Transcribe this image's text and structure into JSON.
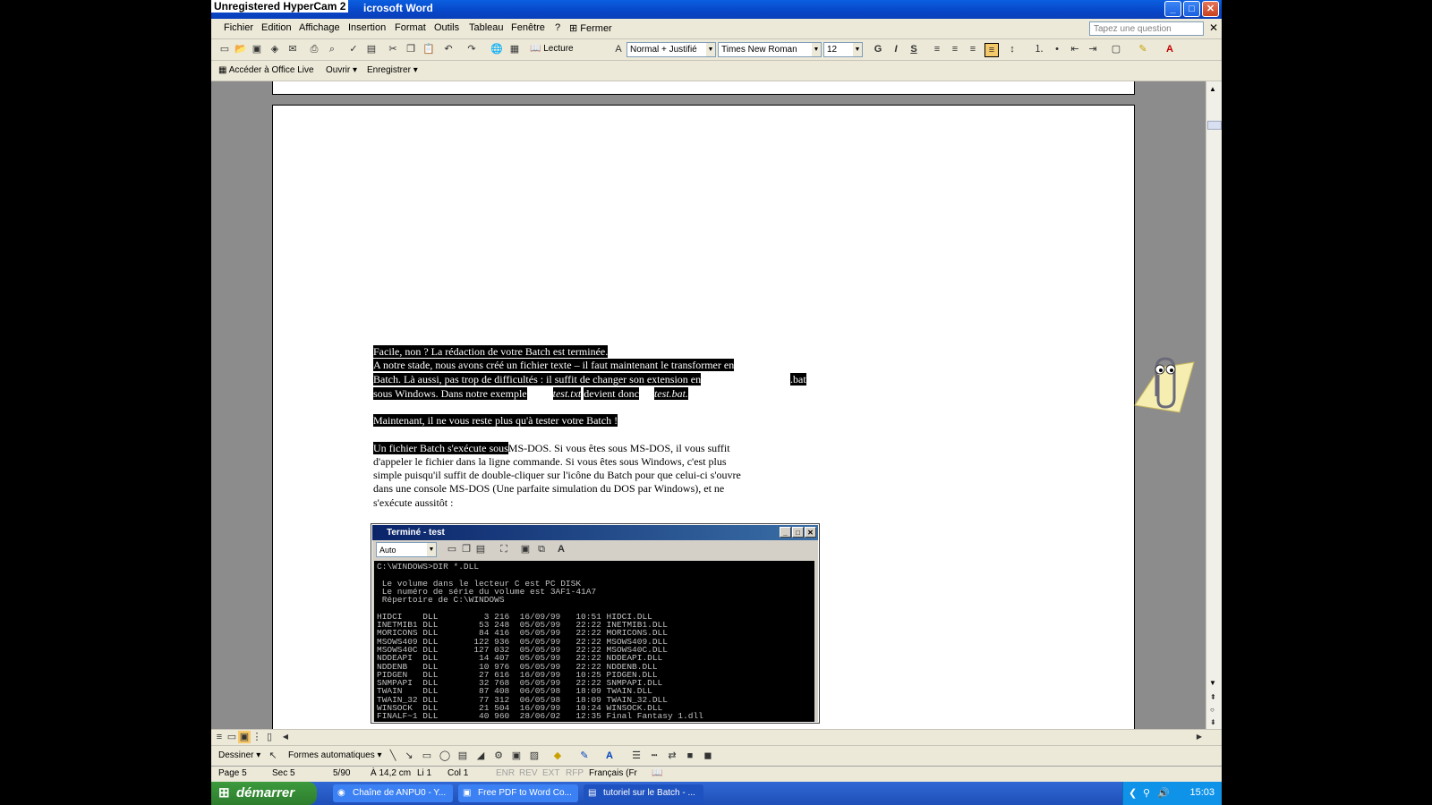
{
  "window": {
    "watermark": "Unregistered HyperCam 2",
    "title": "icrosoft Word",
    "buttons": {
      "minimize": "_",
      "maximize": "□",
      "close": "✕"
    }
  },
  "menu": {
    "items": [
      "Fichier",
      "Edition",
      "Affichage",
      "Insertion",
      "Format",
      "Outils",
      "Tableau",
      "Fenêtre",
      "?"
    ],
    "close_label": "Fermer",
    "help_placeholder": "Tapez une question"
  },
  "toolbar": {
    "reading": "Lecture",
    "style": "Normal + Justifié",
    "font": "Times New Roman",
    "size": "12",
    "bold": "G",
    "italic": "I",
    "strike": "S"
  },
  "toolbar2": {
    "office_live": "Accéder à Office Live",
    "open": "Ouvrir",
    "save": "Enregistrer"
  },
  "document": {
    "lines": [
      "Facile, non ? La rédaction de votre Batch est terminée.",
      "A notre stade, nous avons créé un fichier texte – il faut maintenant le transformer en",
      "Batch. Là aussi, pas trop de difficultés : il suffit de changer son extension en",
      ".bat",
      "sous Windows. Dans notre exemple",
      "test.txt",
      "devient donc",
      "test.bat.",
      "Maintenant, il ne vous reste plus qu'à tester votre Batch !",
      "Un fichier Batch s'exécute sous",
      "MS-DOS. Si vous êtes sous MS-DOS, il vous suffit",
      "d'appeler le fichier dans la ligne commande. Si vous êtes sous Windows, c'est plus",
      "simple puisqu'il suffit de double-cliquer sur l'icône du Batch pour que celui-ci s'ouvre",
      "dans une console MS-DOS (Une parfaite simulation du DOS par Windows), et ne",
      "s'exécute aussitôt :"
    ]
  },
  "console": {
    "title": "Terminé - test",
    "font_select": "Auto",
    "lines": [
      "C:\\WINDOWS>DIR *.DLL",
      "",
      " Le volume dans le lecteur C est PC DISK",
      " Le numéro de série du volume est 3AF1-41A7",
      " Répertoire de C:\\WINDOWS",
      "",
      "HIDCI    DLL         3 216  16/09/99   10:51 HIDCI.DLL",
      "INETMIB1 DLL        53 248  05/05/99   22:22 INETMIB1.DLL",
      "MORICONS DLL        84 416  05/05/99   22:22 MORICONS.DLL",
      "MSOWS409 DLL       122 936  05/05/99   22:22 MSOWS409.DLL",
      "MSOWS40C DLL       127 032  05/05/99   22:22 MSOWS40C.DLL",
      "NDDEAPI  DLL        14 407  05/05/99   22:22 NDDEAPI.DLL",
      "NDDENB   DLL        10 976  05/05/99   22:22 NDDENB.DLL",
      "PIDGEN   DLL        27 616  16/09/99   10:25 PIDGEN.DLL",
      "SNMPAPI  DLL        32 768  05/05/99   22:22 SNMPAPI.DLL",
      "TWAIN    DLL        87 408  06/05/98   18:09 TWAIN.DLL",
      "TWAIN_32 DLL        77 312  06/05/98   18:09 TWAIN_32.DLL",
      "WINSOCK  DLL        21 504  16/09/99   10:24 WINSOCK.DLL",
      "FINALF~1 DLL        40 960  28/06/02   12:35 Final Fantasy 1.dll"
    ]
  },
  "drawing": {
    "draw": "Dessiner",
    "autoshapes": "Formes automatiques"
  },
  "status": {
    "page": "Page 5",
    "section": "Sec 5",
    "pages": "5/90",
    "position": "À 14,2 cm",
    "line": "Li 1",
    "column": "Col 1",
    "rec": "ENR",
    "rev": "REV",
    "ext": "EXT",
    "ovr": "RFP",
    "language": "Français (Fr"
  },
  "taskbar": {
    "start": "démarrer",
    "tasks": [
      "Chaîne de ANPU0 - Y...",
      "Free PDF to Word Co...",
      "tutoriel sur le Batch - ..."
    ],
    "clock": "15:03"
  },
  "colors": {
    "titlebar": "#0a5fe0",
    "taskbar": "#1f4fb8",
    "start": "#2e7d2e",
    "highlight": "#000000"
  }
}
